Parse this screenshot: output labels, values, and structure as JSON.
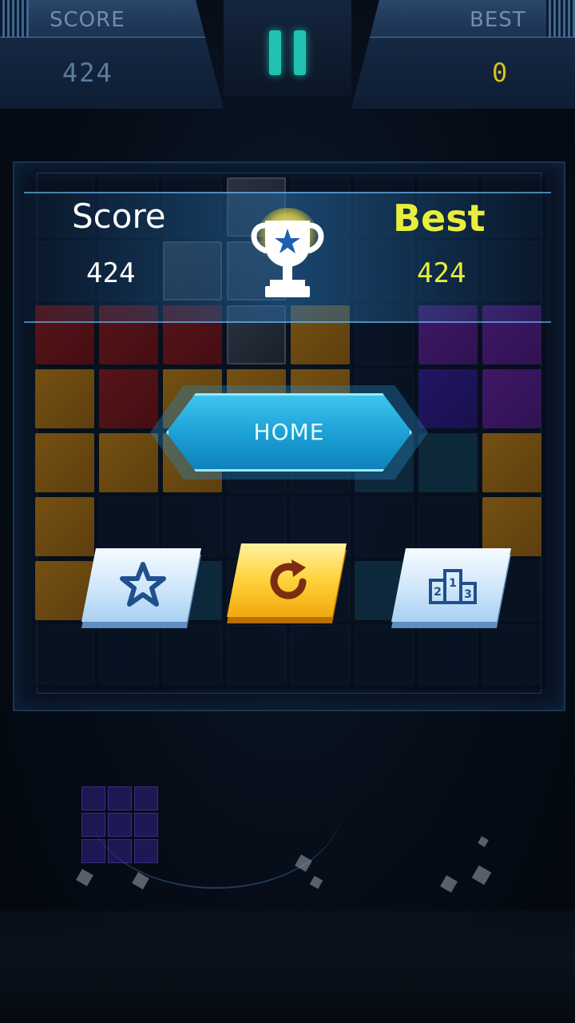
{
  "hud": {
    "score_label": "SCORE",
    "score_value": "424",
    "best_label": "BEST",
    "best_value": "0"
  },
  "result": {
    "score_label": "Score",
    "score_value": "424",
    "best_label": "Best",
    "best_value": "424"
  },
  "buttons": {
    "home_label": "HOME",
    "star_icon": "star-icon",
    "retry_icon": "restart-icon",
    "rank_icon": "podium-icon",
    "podium_numbers": [
      "2",
      "1",
      "3"
    ]
  },
  "colors": {
    "accent_teal": "#21c3b0",
    "best_yellow": "#e9ee3c",
    "home_blue": "#1a9ed4",
    "retry_gold": "#ffd23a"
  },
  "board": {
    "rows": [
      [
        "empty",
        "empty",
        "empty",
        "gray",
        "empty",
        "empty",
        "empty",
        "empty"
      ],
      [
        "empty",
        "empty",
        "gray",
        "gray",
        "empty",
        "empty",
        "empty",
        "empty"
      ],
      [
        "red",
        "red",
        "red",
        "gray",
        "orange",
        "empty",
        "purple",
        "purple"
      ],
      [
        "orange",
        "red",
        "orange",
        "orange",
        "orange",
        "empty",
        "blue",
        "purple"
      ],
      [
        "orange",
        "orange",
        "orange",
        "empty",
        "empty",
        "teal",
        "teal",
        "orange"
      ],
      [
        "orange",
        "empty",
        "empty",
        "empty",
        "empty",
        "empty",
        "empty",
        "orange"
      ],
      [
        "orange",
        "empty",
        "teal",
        "empty",
        "empty",
        "teal",
        "empty",
        "empty"
      ],
      [
        "empty",
        "empty",
        "empty",
        "empty",
        "empty",
        "empty",
        "empty",
        "empty"
      ]
    ]
  },
  "next_piece": {
    "color": "blue",
    "shape": "3x3-square"
  }
}
